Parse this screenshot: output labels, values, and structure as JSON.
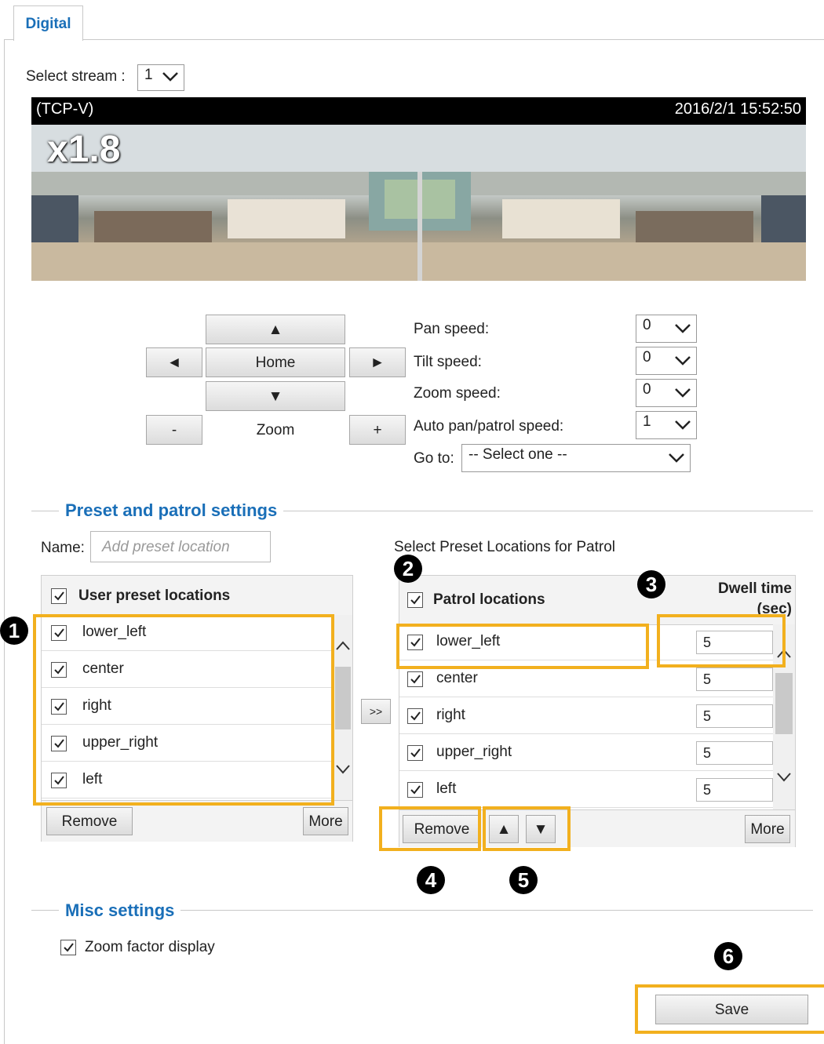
{
  "tab": {
    "label": "Digital"
  },
  "stream": {
    "label": "Select stream :",
    "value": "1"
  },
  "video": {
    "protocol": "(TCP-V)",
    "timestamp": "2016/2/1 15:52:50",
    "zoom_factor": "x1.8"
  },
  "ptz": {
    "up": "▲",
    "down": "▼",
    "left": "◄",
    "right": "►",
    "home": "Home",
    "zoom_label": "Zoom",
    "zoom_out": "-",
    "zoom_in": "+"
  },
  "speeds": {
    "pan_label": "Pan speed:",
    "pan_value": "0",
    "tilt_label": "Tilt speed:",
    "tilt_value": "0",
    "zoom_label": "Zoom speed:",
    "zoom_value": "0",
    "auto_label": "Auto pan/patrol speed:",
    "auto_value": "1",
    "goto_label": "Go to:",
    "goto_value": "-- Select one --"
  },
  "preset_section": {
    "title": "Preset and patrol settings",
    "name_label": "Name:",
    "name_placeholder": "Add preset location",
    "patrol_caption": "Select Preset Locations for Patrol",
    "user_header": "User preset locations",
    "user_items": [
      "lower_left",
      "center",
      "right",
      "upper_right",
      "left"
    ],
    "remove": "Remove",
    "more": "More",
    "transfer": ">>",
    "patrol_header": "Patrol locations",
    "dwell_header_1": "Dwell time",
    "dwell_header_2": "(sec)",
    "patrol_items": [
      {
        "name": "lower_left",
        "dwell": "5"
      },
      {
        "name": "center",
        "dwell": "5"
      },
      {
        "name": "right",
        "dwell": "5"
      },
      {
        "name": "upper_right",
        "dwell": "5"
      },
      {
        "name": "left",
        "dwell": "5"
      }
    ],
    "move_up": "▲",
    "move_down": "▼"
  },
  "misc_section": {
    "title": "Misc settings",
    "zoom_display": "Zoom factor display"
  },
  "save": "Save",
  "callouts": [
    "1",
    "2",
    "3",
    "4",
    "5",
    "6"
  ],
  "highlight_color": "#f2b01e",
  "accent_color": "#1a6fb8"
}
